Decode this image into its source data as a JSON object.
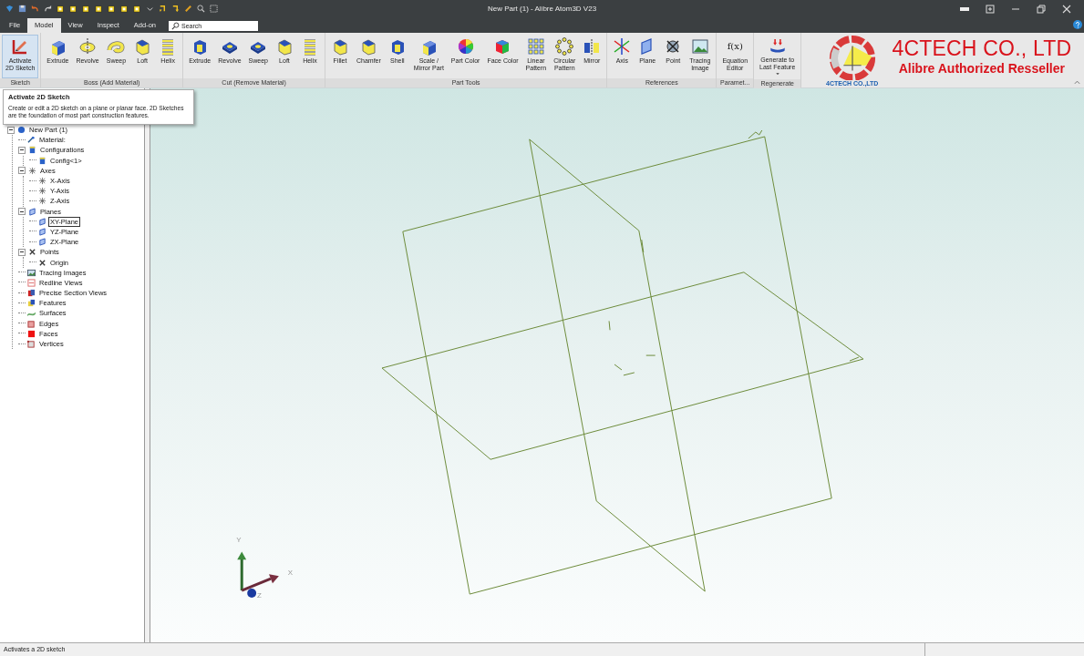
{
  "window": {
    "title": "New Part (1) - Alibre Atom3D V23"
  },
  "tabs": [
    {
      "label": "File",
      "selected": false
    },
    {
      "label": "Model",
      "selected": true
    },
    {
      "label": "View",
      "selected": false
    },
    {
      "label": "Inspect",
      "selected": false
    },
    {
      "label": "Add-on",
      "selected": false
    }
  ],
  "search": {
    "placeholder": "Search"
  },
  "ribbon": {
    "groups": [
      {
        "label": "Sketch",
        "buttons": [
          {
            "label": "Activate\n2D Sketch",
            "kind": "sketch",
            "highlighted": true
          }
        ]
      },
      {
        "label": "Boss (Add Material)",
        "buttons": [
          {
            "label": "Extrude",
            "kind": "block",
            "highlighted": false
          },
          {
            "label": "Revolve",
            "kind": "ring",
            "highlighted": false
          },
          {
            "label": "Sweep",
            "kind": "tube",
            "highlighted": false
          },
          {
            "label": "Loft",
            "kind": "wedge",
            "highlighted": false
          },
          {
            "label": "Helix",
            "kind": "spring",
            "highlighted": false
          }
        ]
      },
      {
        "label": "Cut (Remove Material)",
        "buttons": [
          {
            "label": "Extrude",
            "kind": "cutblock",
            "highlighted": false
          },
          {
            "label": "Revolve",
            "kind": "plate",
            "highlighted": false
          },
          {
            "label": "Sweep",
            "kind": "plate",
            "highlighted": false
          },
          {
            "label": "Loft",
            "kind": "wedge",
            "highlighted": false
          },
          {
            "label": "Helix",
            "kind": "spring",
            "highlighted": false
          }
        ]
      },
      {
        "label": "Part Tools",
        "buttons": [
          {
            "label": "Fillet",
            "kind": "wedge",
            "highlighted": false
          },
          {
            "label": "Chamfer",
            "kind": "wedge",
            "highlighted": false
          },
          {
            "label": "Shell",
            "kind": "cutblock",
            "highlighted": false
          },
          {
            "label": "Scale /\nMirror Part",
            "kind": "block",
            "highlighted": false
          },
          {
            "label": "Part Color",
            "kind": "wheel",
            "highlighted": false
          },
          {
            "label": "Face Color",
            "kind": "cube",
            "highlighted": false
          },
          {
            "label": "Linear\nPattern",
            "kind": "grid",
            "highlighted": false
          },
          {
            "label": "Circular\nPattern",
            "kind": "dotring",
            "highlighted": false
          },
          {
            "label": "Mirror",
            "kind": "mirror",
            "highlighted": false
          }
        ]
      },
      {
        "label": "References",
        "buttons": [
          {
            "label": "Axis",
            "kind": "asterisk",
            "highlighted": false
          },
          {
            "label": "Plane",
            "kind": "plane",
            "highlighted": false
          },
          {
            "label": "Point",
            "kind": "point",
            "highlighted": false
          },
          {
            "label": "Tracing\nImage",
            "kind": "picture",
            "highlighted": false
          }
        ]
      },
      {
        "label": "Paramet...",
        "buttons": [
          {
            "label": "Equation\nEditor",
            "kind": "glyph",
            "glyph": "f(x)",
            "highlighted": false
          }
        ]
      },
      {
        "label": "Regenerate",
        "buttons": [
          {
            "label": "Generate to\nLast Feature",
            "kind": "generate",
            "highlighted": false
          }
        ]
      }
    ]
  },
  "logo": {
    "title": "4CTECH CO., LTD",
    "subtitle": "Alibre Authorized Resseller",
    "caption": "4CTECH CO.,LTD"
  },
  "tooltip": {
    "title": "Activate 2D Sketch",
    "text": "Create or edit a 2D sketch on a plane or planar face. 2D Sketches are the foundation of most part construction features."
  },
  "tree": [
    {
      "label": "New Part (1)",
      "kind": "part",
      "selected": false,
      "expanded": true,
      "children": [
        {
          "label": "Material:",
          "kind": "material",
          "selected": false
        },
        {
          "label": "Configurations",
          "kind": "config",
          "selected": false,
          "expanded": true,
          "children": [
            {
              "label": "Config<1>",
              "kind": "config",
              "selected": false
            }
          ]
        },
        {
          "label": "Axes",
          "kind": "axis",
          "selected": false,
          "expanded": true,
          "children": [
            {
              "label": "X-Axis",
              "kind": "axis",
              "selected": false
            },
            {
              "label": "Y-Axis",
              "kind": "axis",
              "selected": false
            },
            {
              "label": "Z-Axis",
              "kind": "axis",
              "selected": false
            }
          ]
        },
        {
          "label": "Planes",
          "kind": "plane",
          "selected": false,
          "expanded": true,
          "children": [
            {
              "label": "XY-Plane",
              "kind": "plane",
              "selected": true
            },
            {
              "label": "YZ-Plane",
              "kind": "plane",
              "selected": false
            },
            {
              "label": "ZX-Plane",
              "kind": "plane",
              "selected": false
            }
          ]
        },
        {
          "label": "Points",
          "kind": "point",
          "selected": false,
          "expanded": true,
          "children": [
            {
              "label": "Origin",
              "kind": "point",
              "selected": false
            }
          ]
        },
        {
          "label": "Tracing Images",
          "kind": "picture",
          "selected": false
        },
        {
          "label": "Redline Views",
          "kind": "redline",
          "selected": false
        },
        {
          "label": "Precise Section Views",
          "kind": "section",
          "selected": false
        },
        {
          "label": "Features",
          "kind": "features",
          "selected": false
        },
        {
          "label": "Surfaces",
          "kind": "surfaces",
          "selected": false
        },
        {
          "label": "Edges",
          "kind": "edges",
          "selected": false
        },
        {
          "label": "Faces",
          "kind": "faces",
          "selected": false
        },
        {
          "label": "Vertices",
          "kind": "vertices",
          "selected": false
        }
      ]
    }
  ],
  "viewport": {
    "axes": {
      "x": "X",
      "y": "Y",
      "z": "Z"
    }
  },
  "status_bar": {
    "text": "Activates a 2D sketch"
  }
}
